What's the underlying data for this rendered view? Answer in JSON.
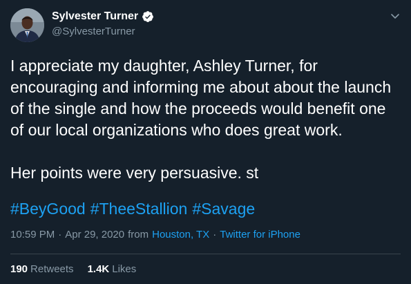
{
  "user": {
    "display_name": "Sylvester Turner",
    "handle": "@SylvesterTurner",
    "verified": true
  },
  "tweet": {
    "paragraph1": "I appreciate my daughter, Ashley Turner, for encouraging and informing me about about the launch of the single and how the proceeds would benefit one of our local organizations who does great work.",
    "paragraph2": "Her points were very persuasive. st",
    "hashtags": [
      "#BeyGood",
      "#TheeStallion",
      "#Savage"
    ]
  },
  "meta": {
    "time": "10:59 PM",
    "separator": "·",
    "date": "Apr 29, 2020",
    "from_label": "from",
    "location": "Houston, TX",
    "source": "Twitter for iPhone"
  },
  "stats": {
    "retweets_count": "190",
    "retweets_label": "Retweets",
    "likes_count": "1.4K",
    "likes_label": "Likes"
  },
  "icons": {
    "verified": "verified-badge-icon",
    "caret": "chevron-down-icon"
  },
  "colors": {
    "background": "#15202b",
    "text": "#ffffff",
    "secondary": "#8899a6",
    "accent": "#1da1f2",
    "divider": "#38444d"
  }
}
